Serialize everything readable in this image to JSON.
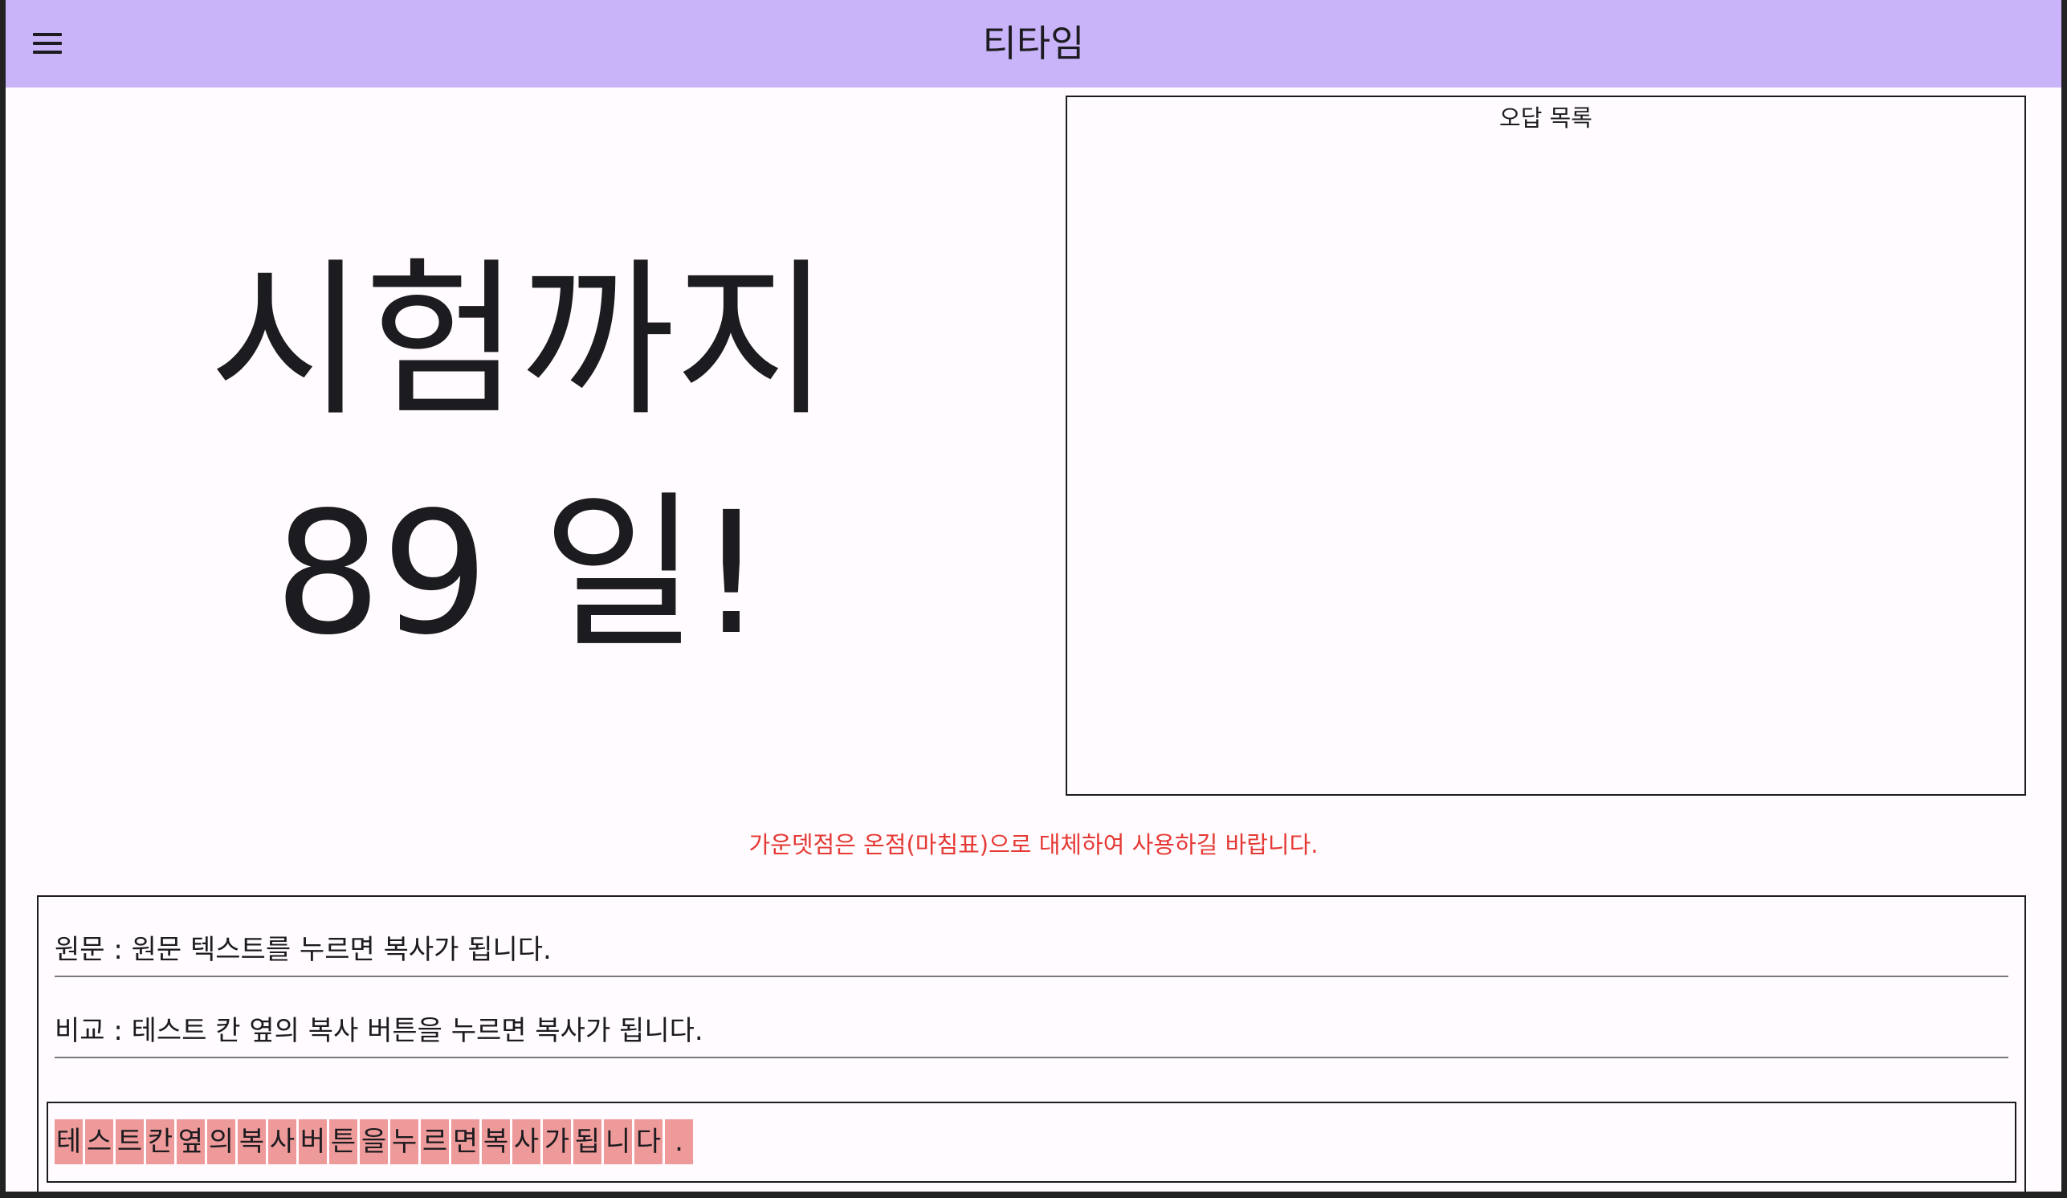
{
  "app": {
    "title": "티타임",
    "menu_icon": "hamburger-menu-icon"
  },
  "countdown": {
    "line1": "시험까지",
    "line2": "89 일!"
  },
  "wrong_answers": {
    "title": "오답 목록"
  },
  "notice": "가운뎃점은 온점(마침표)으로 대체하여 사용하길 바랍니다.",
  "fields": {
    "original": "원문 : 원문 텍스트를 누르면 복사가 됩니다.",
    "compare": "비교 : 테스트 칸 옆의 복사 버튼을 누르면 복사가 됩니다."
  },
  "typing": {
    "chars": [
      "테",
      "스",
      "트",
      "칸",
      "옆",
      "의",
      "복",
      "사",
      "버",
      "튼",
      "을",
      "누",
      "르",
      "면",
      "복",
      "사",
      "가",
      "됩",
      "니",
      "다",
      "."
    ],
    "highlight_color": "#ee9a9a"
  },
  "colors": {
    "appbar": "#c9b3f9",
    "notice": "#e53935"
  }
}
